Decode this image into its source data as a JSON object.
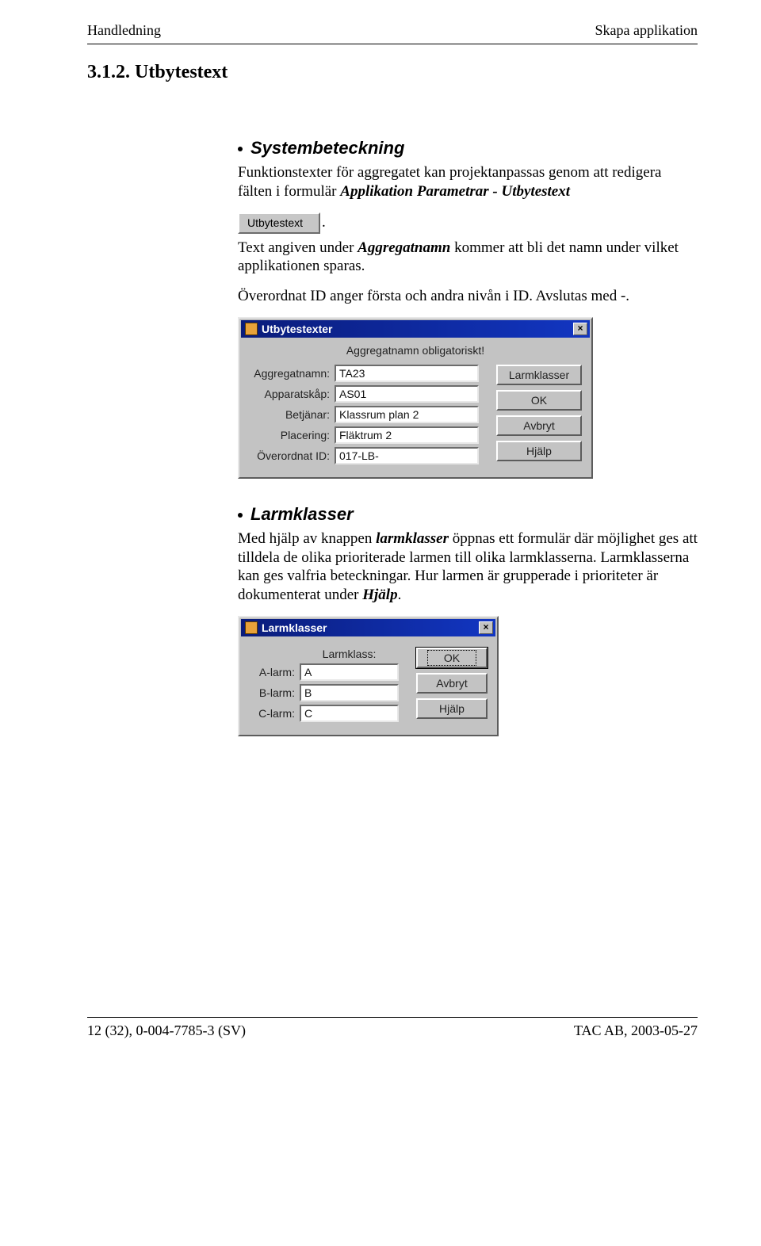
{
  "header": {
    "left": "Handledning",
    "right": "Skapa applikation"
  },
  "section": {
    "number": "3.1.2. Utbytestext"
  },
  "section_systembeteckning": {
    "title": "Systembeteckning",
    "p1_a": "Funktionstexter för aggregatet kan projektanpassas genom att redigera fälten i formulär ",
    "p1_b": "Applikation Parametrar - Utbytestext",
    "button_label": "Utbytestext",
    "trail_dot": ".",
    "p2_a": "Text angiven under ",
    "p2_b": "Aggregatnamn",
    "p2_c": " kommer att bli det namn under vilket applikationen sparas.",
    "p3": "Överordnat ID anger första och andra nivån i ID. Avslutas med -."
  },
  "dialog1": {
    "title": "Utbytestexter",
    "hint": "Aggregatnamn obligatoriskt!",
    "fields": {
      "aggregatnamn": {
        "label": "Aggregatnamn:",
        "value": "TA23"
      },
      "apparatskap": {
        "label": "Apparatskåp:",
        "value": "AS01"
      },
      "betjanar": {
        "label": "Betjänar:",
        "value": "Klassrum plan 2"
      },
      "placering": {
        "label": "Placering:",
        "value": "Fläktrum 2"
      },
      "overordnat": {
        "label": "Överordnat ID:",
        "value": "017-LB-"
      }
    },
    "buttons": {
      "larmklasser": "Larmklasser",
      "ok": "OK",
      "avbryt": "Avbryt",
      "hjalp": "Hjälp"
    }
  },
  "section_larmklasser": {
    "title": "Larmklasser",
    "p1_a": "Med hjälp av knappen ",
    "p1_b": "larmklasser",
    "p1_c": " öppnas ett formulär där möjlighet ges att tilldela de olika prioriterade larmen till olika larmklasserna. Larmklasserna kan ges valfria beteckningar. Hur larmen är grupperade i prioriteter är dokumenterat under ",
    "p1_d": "Hjälp",
    "p1_e": "."
  },
  "dialog2": {
    "title": "Larmklasser",
    "header_label": "Larmklass:",
    "fields": {
      "a": {
        "label": "A-larm:",
        "value": "A"
      },
      "b": {
        "label": "B-larm:",
        "value": "B"
      },
      "c": {
        "label": "C-larm:",
        "value": "C"
      }
    },
    "buttons": {
      "ok": "OK",
      "avbryt": "Avbryt",
      "hjalp": "Hjälp"
    }
  },
  "footer": {
    "left": "12 (32), 0-004-7785-3 (SV)",
    "right": "TAC AB, 2003-05-27"
  }
}
